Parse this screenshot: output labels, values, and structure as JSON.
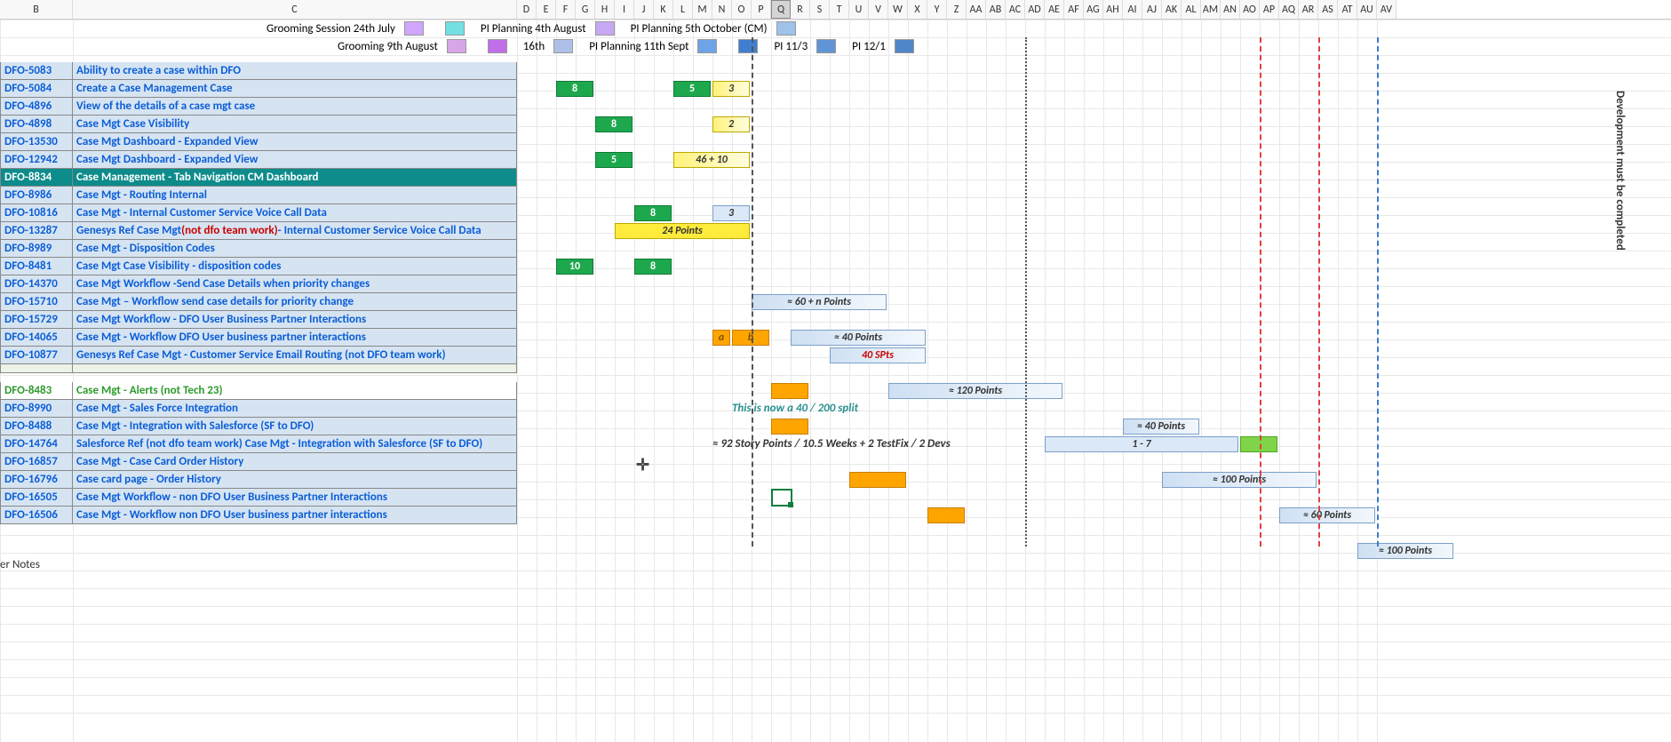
{
  "columns": [
    "B",
    "C",
    "D",
    "E",
    "F",
    "G",
    "H",
    "I",
    "J",
    "K",
    "L",
    "M",
    "N",
    "O",
    "P",
    "Q",
    "R",
    "S",
    "T",
    "U",
    "V",
    "W",
    "X",
    "Y",
    "Z",
    "AA",
    "AB",
    "AC",
    "AD",
    "AE",
    "AF",
    "AG",
    "AH",
    "AI",
    "AJ",
    "AK",
    "AL",
    "AM",
    "AN",
    "AO",
    "AP",
    "AQ",
    "AR",
    "AS",
    "AT",
    "AU",
    "AV"
  ],
  "col_widths": {
    "B": 82,
    "C": 500,
    "narrow": 22,
    "wide": 40
  },
  "selected_column": "Q",
  "legend": {
    "row1": [
      {
        "label": "Grooming Session 24th July",
        "swatches": [
          "#d1a6ff",
          "#72e0e0"
        ]
      },
      {
        "label": "PI Planning 4th August",
        "swatches": [
          "#c7a8f5"
        ]
      },
      {
        "label": "PI Planning 5th October (CM)",
        "swatches": [
          "#9fc2e8"
        ]
      }
    ],
    "row2": [
      {
        "label": "Grooming 9th August",
        "swatches": [
          "#d6a6e8",
          "#c06fe8"
        ]
      },
      {
        "label": "16th",
        "swatches": [
          "#aebfe8"
        ]
      },
      {
        "label": "PI Planning 11th Sept",
        "swatches": [
          "#6fa3e8",
          "#3f7fd1"
        ]
      },
      {
        "label": "PI 11/3",
        "swatches": [
          "#5f95d6"
        ]
      },
      {
        "label": "PI 12/1",
        "swatches": [
          "#4f85c9"
        ]
      }
    ]
  },
  "rows": [
    {
      "id": "DFO-5083",
      "desc": "Ability to create a case within DFO"
    },
    {
      "id": "DFO-5084",
      "desc": "Create a Case Management Case"
    },
    {
      "id": "DFO-4896",
      "desc": "View of the details of a case mgt case"
    },
    {
      "id": "DFO-4898",
      "desc": "Case Mgt Case Visibility"
    },
    {
      "id": "DFO-13530",
      "desc": "Case Mgt Dashboard - Expanded View"
    },
    {
      "id": "DFO-12942",
      "desc": "Case Mgt Dashboard - Expanded View"
    },
    {
      "id": "DFO-8834",
      "desc": "Case Management - Tab Navigation CM Dashboard",
      "style": "teal"
    },
    {
      "id": "DFO-8986",
      "desc": "Case Mgt - Routing Internal"
    },
    {
      "id": "DFO-10816",
      "desc": "Case Mgt - Internal Customer Service Voice Call Data"
    },
    {
      "id": "DFO-13287",
      "desc": "Genesys Ref Case Mgt ",
      "red": "(not dfo team work)",
      "desc2": " - Internal Customer Service Voice Call Data"
    },
    {
      "id": "DFO-8989",
      "desc": "Case Mgt - Disposition Codes"
    },
    {
      "id": "DFO-8481",
      "desc": "Case Mgt Case Visibility - disposition codes"
    },
    {
      "id": "DFO-14370",
      "desc": "Case Mgt Workflow -Send Case Details when priority changes"
    },
    {
      "id": "DFO-15710",
      "desc": "Case Mgt – Workflow send case details for priority change"
    },
    {
      "id": "DFO-15729",
      "desc": "Case Mgt Workflow - DFO User Business Partner Interactions"
    },
    {
      "id": "DFO-14065",
      "desc": "Case Mgt - Workflow DFO User business partner interactions"
    },
    {
      "id": "DFO-10877",
      "desc": "Genesys Ref Case Mgt - Customer Service Email Routing (not DFO team work)"
    },
    {
      "id": "",
      "desc": "",
      "style": "pale"
    },
    {
      "id": "DFO-8483",
      "desc": "Case Mgt - Alerts (not Tech 23)",
      "style": "green"
    },
    {
      "id": "DFO-8990",
      "desc": "Case Mgt - Sales Force Integration"
    },
    {
      "id": "DFO-8488",
      "desc": "Case Mgt - Integration with Salesforce (SF to DFO)"
    },
    {
      "id": "DFO-14764",
      "desc": "Salesforce Ref (not dfo team work) Case Mgt - Integration with Salesforce (SF to DFO)"
    },
    {
      "id": "DFO-16857",
      "desc": "Case Mgt - Case Card Order History"
    },
    {
      "id": "DFO-16796",
      "desc": "Case card page - Order History"
    },
    {
      "id": "DFO-16505",
      "desc": "Case Mgt Workflow - non DFO User Business Partner Interactions"
    },
    {
      "id": "DFO-16506",
      "desc": "Case Mgt - Workflow non DFO User business partner interactions"
    }
  ],
  "bars": [
    {
      "row": 1,
      "colStart": "F",
      "span": 2,
      "label": "8",
      "style": "green"
    },
    {
      "row": 1,
      "colStart": "L",
      "span": 2,
      "label": "5",
      "style": "green"
    },
    {
      "row": 1,
      "colStart": "N",
      "span": 2,
      "label": "3",
      "style": "yellow"
    },
    {
      "row": 3,
      "colStart": "H",
      "span": 2,
      "label": "8",
      "style": "green"
    },
    {
      "row": 3,
      "colStart": "N",
      "span": 2,
      "label": "2",
      "style": "yellow"
    },
    {
      "row": 5,
      "colStart": "H",
      "span": 2,
      "label": "5",
      "style": "green"
    },
    {
      "row": 5,
      "colStart": "L",
      "span": 4,
      "label": "46 + 10",
      "style": "yellow"
    },
    {
      "row": 8,
      "colStart": "J",
      "span": 2,
      "label": "8",
      "style": "green"
    },
    {
      "row": 8,
      "colStart": "N",
      "span": 2,
      "label": "3",
      "style": "bluepale"
    },
    {
      "row": 9,
      "colStart": "I",
      "span": 7,
      "label": "24 Points",
      "style": "yellow-solid"
    },
    {
      "row": 11,
      "colStart": "F",
      "span": 2,
      "label": "10",
      "style": "green"
    },
    {
      "row": 11,
      "colStart": "J",
      "span": 2,
      "label": "8",
      "style": "green"
    },
    {
      "row": 13,
      "colStart": "P",
      "span": 7,
      "label": "≈ 60 + n Points",
      "style": "blue"
    },
    {
      "row": 15,
      "colStart": "N",
      "span": 1,
      "label": "a",
      "style": "orange"
    },
    {
      "row": 15,
      "colStart": "O",
      "span": 2,
      "label": "b",
      "style": "orange"
    },
    {
      "row": 15,
      "colStart": "R",
      "span": 7,
      "label": "≈ 40 Points",
      "style": "blue"
    },
    {
      "row": 16,
      "colStart": "T",
      "span": 5,
      "label": "40 SPts",
      "style": "blue",
      "textStyle": "red"
    },
    {
      "row": 18,
      "colStart": "Q",
      "span": 2,
      "label": "",
      "style": "orange-empty"
    },
    {
      "row": 18,
      "colStart": "W",
      "span": 9,
      "label": "≈ 120 Points",
      "style": "blue"
    },
    {
      "row": 20,
      "colStart": "Q",
      "span": 2,
      "label": "",
      "style": "orange-empty"
    },
    {
      "row": 20,
      "colStart": "AI",
      "span": 4,
      "label": "≈ 40 Points",
      "style": "blue"
    },
    {
      "row": 21,
      "colStart": "AE",
      "span": 10,
      "label": "1 - 7",
      "style": "bluepale"
    },
    {
      "row": 21,
      "colStart": "AO",
      "span": 2,
      "label": "",
      "style": "limegreen"
    },
    {
      "row": 23,
      "colStart": "U",
      "span": 3,
      "label": "",
      "style": "orange-empty"
    },
    {
      "row": 23,
      "colStart": "AK",
      "span": 8,
      "label": "≈ 100 Points",
      "style": "blue"
    },
    {
      "row": 25,
      "colStart": "Y",
      "span": 2,
      "label": "",
      "style": "orange-empty"
    },
    {
      "row": 25,
      "colStart": "AQ",
      "span": 5,
      "label": "≈ 60 Points",
      "style": "blue"
    },
    {
      "row": 27,
      "colStart": "AU",
      "span": 5,
      "label": "≈ 100 Points",
      "style": "blue"
    }
  ],
  "annotations": [
    {
      "row": 19,
      "col": "O",
      "text": "This is now a 40 / 200 split"
    },
    {
      "row": 21,
      "col": "N",
      "text": "≈ 92 Story Points / 10.5 Weeks + 2 TestFix / 2 Devs",
      "style": "plain"
    }
  ],
  "vertical_text": "Development must be completed",
  "dashed_lines": [
    {
      "col": "P",
      "style": "black"
    },
    {
      "col": "AD",
      "style": "black",
      "dotted": true
    },
    {
      "col": "AP",
      "style": "red"
    },
    {
      "col": "AS",
      "style": "red"
    },
    {
      "col": "AV",
      "style": "blue"
    }
  ],
  "footer": "er Notes",
  "cursor_pos": {
    "row": 22,
    "col": "J"
  },
  "selection_pos": {
    "row": 24,
    "col": "Q"
  }
}
